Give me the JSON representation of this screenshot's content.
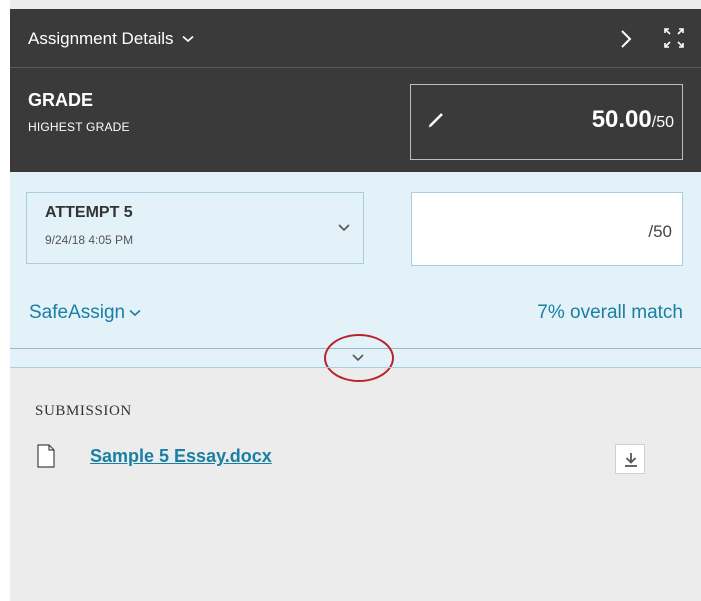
{
  "header": {
    "title": "Assignment Details",
    "chevron_icon": "chevron-down-icon",
    "next_icon": "chevron-right-icon",
    "expand_icon": "expand-icon",
    "bg_color": "#3a3a3a"
  },
  "grade": {
    "label": "GRADE",
    "sublabel": "HIGHEST GRADE",
    "value": "50.00",
    "max": "/50",
    "edit_icon": "pencil-icon"
  },
  "attempt": {
    "title": "ATTEMPT 5",
    "date": "9/24/18 4:05 PM",
    "score_max": "/50",
    "bg_color": "#e3f1f8"
  },
  "safeassign": {
    "label": "SafeAssign",
    "match": "7% overall match",
    "toggle_icon": "chevron-down-icon",
    "link_color": "#1a7fa2",
    "highlight_color": "#b8232b"
  },
  "submission": {
    "label": "SUBMISSION",
    "file_name": "Sample 5 Essay.docx",
    "file_icon": "document-icon",
    "download_icon": "download-icon"
  }
}
